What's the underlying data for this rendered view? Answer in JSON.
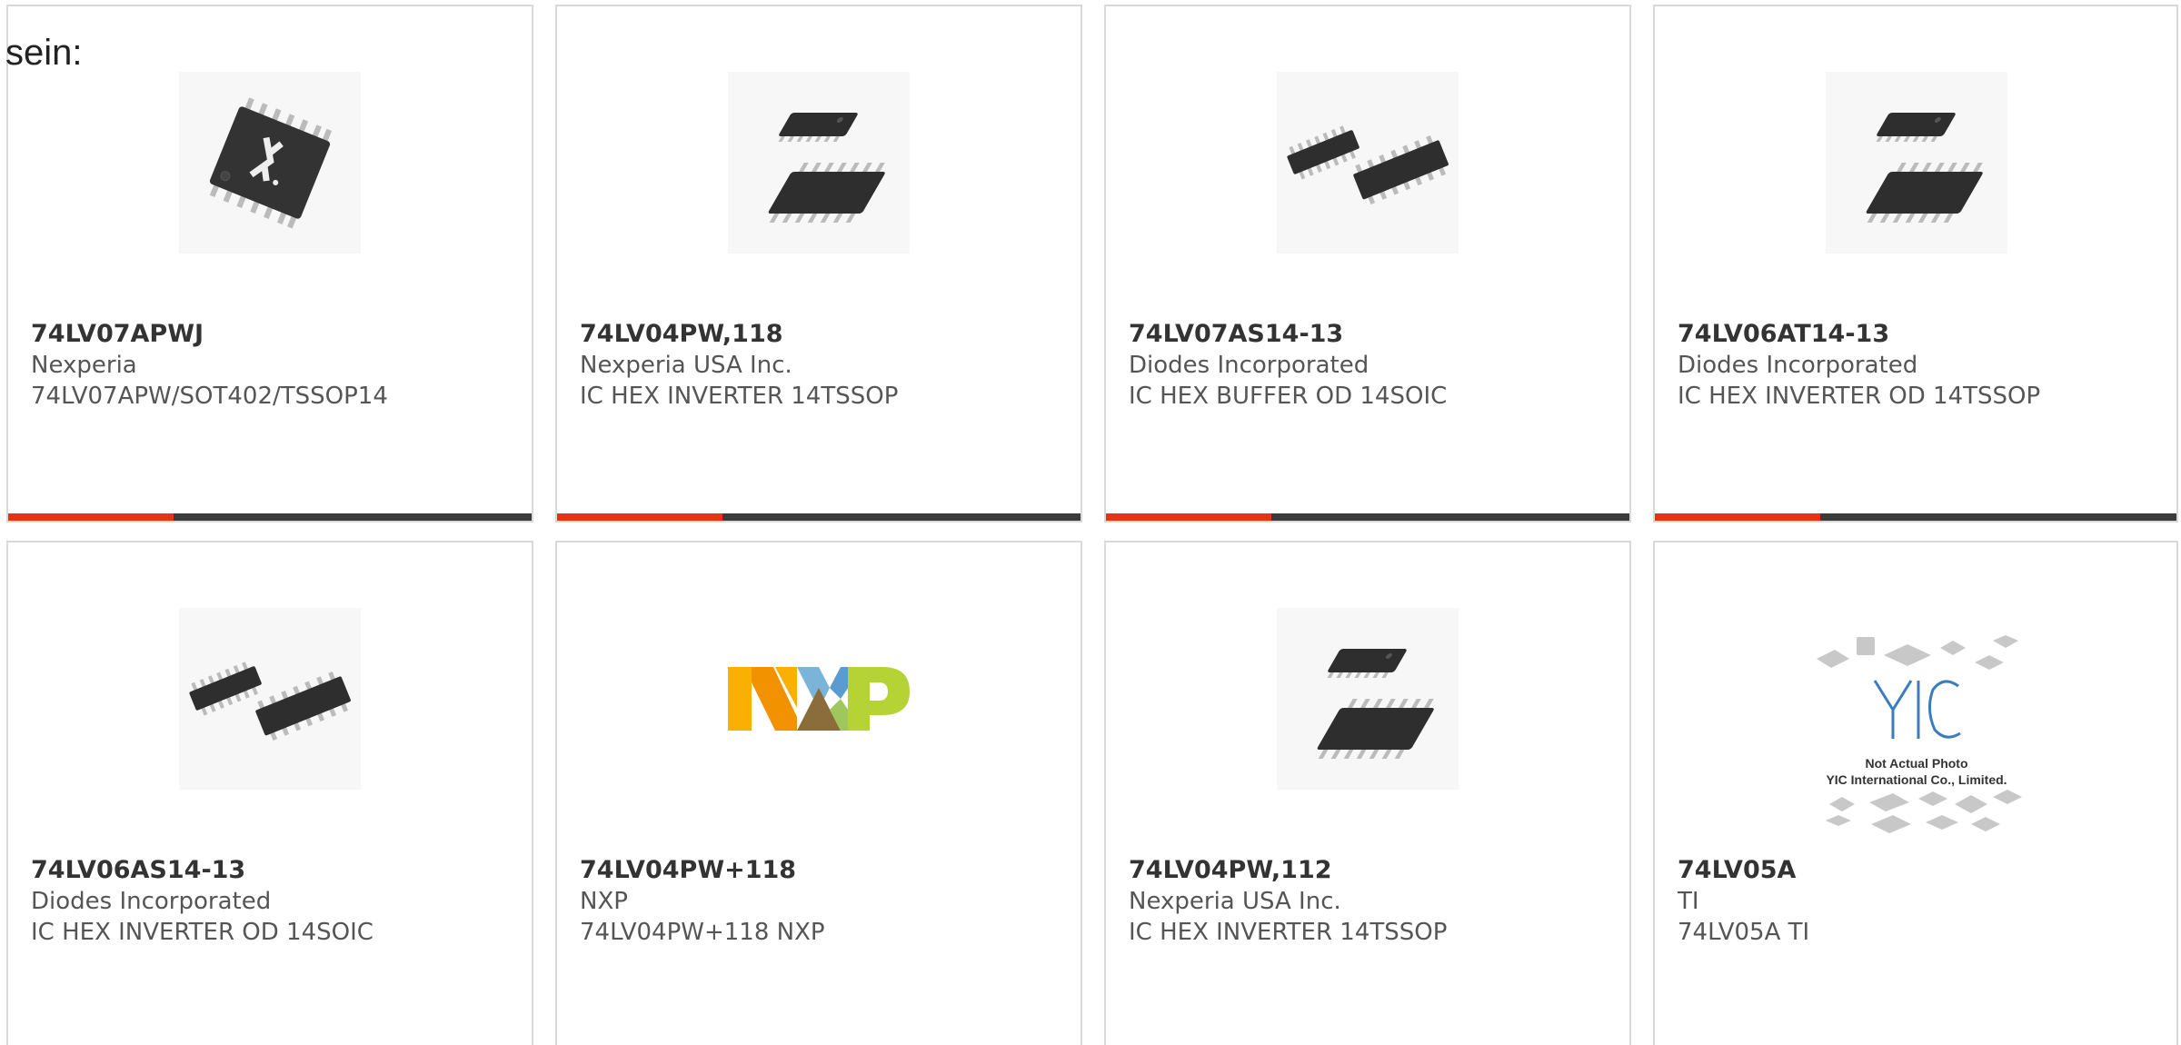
{
  "intro_text": "sein:",
  "colors": {
    "accent": "#e63312",
    "bar": "#3a3a3a",
    "border": "#d9d9d9"
  },
  "products": [
    {
      "part": "74LV07APWJ",
      "manufacturer": "Nexperia",
      "description": "74LV07APW/SOT402/TSSOP14",
      "image": "nexperia-chip-icon"
    },
    {
      "part": "74LV04PW,118",
      "manufacturer": "Nexperia USA Inc.",
      "description": "IC HEX INVERTER 14TSSOP",
      "image": "tssop-chips-icon"
    },
    {
      "part": "74LV07AS14-13",
      "manufacturer": "Diodes Incorporated",
      "description": "IC HEX BUFFER OD 14SOIC",
      "image": "soic-chips-icon"
    },
    {
      "part": "74LV06AT14-13",
      "manufacturer": "Diodes Incorporated",
      "description": "IC HEX INVERTER OD 14TSSOP",
      "image": "tssop-chips-icon"
    },
    {
      "part": "74LV06AS14-13",
      "manufacturer": "Diodes Incorporated",
      "description": "IC HEX INVERTER OD 14SOIC",
      "image": "soic-chips-icon"
    },
    {
      "part": "74LV04PW+118",
      "manufacturer": "NXP",
      "description": "74LV04PW+118 NXP",
      "image": "nxp-logo"
    },
    {
      "part": "74LV04PW,112",
      "manufacturer": "Nexperia USA Inc.",
      "description": "IC HEX INVERTER 14TSSOP",
      "image": "tssop-chips-icon"
    },
    {
      "part": "74LV05A",
      "manufacturer": "TI",
      "description": "74LV05A TI",
      "image": "yic-placeholder",
      "image_caption": [
        "Not Actual Photo",
        "YIC International Co., Limited."
      ]
    }
  ]
}
